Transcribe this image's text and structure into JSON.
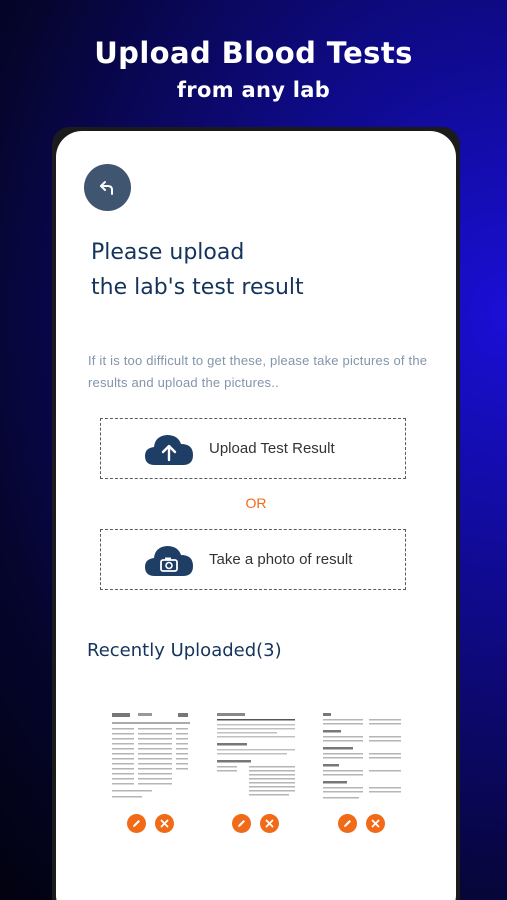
{
  "hero": {
    "title": "Upload Blood Tests",
    "subtitle": "from any lab"
  },
  "card": {
    "heading_line1": "Please upload",
    "heading_line2": "the lab's test result",
    "hint": "If it is too difficult to get these, please take pictures of the results and upload the pictures..",
    "upload_label": "Upload Test Result",
    "or_label": "OR",
    "photo_label": "Take a photo of result",
    "recent_title": "Recently Uploaded(3)"
  },
  "recent_uploads": [
    {
      "type": "document-thumbnail"
    },
    {
      "type": "document-thumbnail"
    },
    {
      "type": "document-thumbnail"
    }
  ],
  "colors": {
    "accent": "#f06a18",
    "navy": "#15345c",
    "icon_bg": "#1f3e66",
    "back_btn": "#3f5570"
  }
}
